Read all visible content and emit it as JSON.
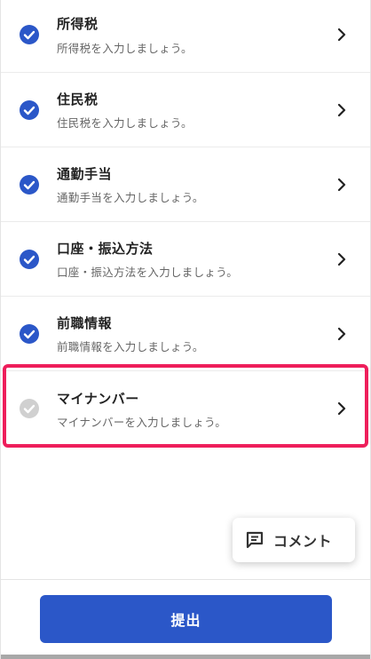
{
  "items": [
    {
      "title": "所得税",
      "subtitle": "所得税を入力しましょう。",
      "completed": true
    },
    {
      "title": "住民税",
      "subtitle": "住民税を入力しましょう。",
      "completed": true
    },
    {
      "title": "通勤手当",
      "subtitle": "通勤手当を入力しましょう。",
      "completed": true
    },
    {
      "title": "口座・振込方法",
      "subtitle": "口座・振込方法を入力しましょう。",
      "completed": true
    },
    {
      "title": "前職情報",
      "subtitle": "前職情報を入力しましょう。",
      "completed": true
    },
    {
      "title": "マイナンバー",
      "subtitle": "マイナンバーを入力しましょう。",
      "completed": false
    }
  ],
  "comment_button": {
    "label": "コメント",
    "icon": "comment-icon"
  },
  "submit_button": {
    "label": "提出"
  },
  "colors": {
    "check_done": "#2b57c8",
    "check_pending": "#d0d0d0",
    "highlight": "#ee1e5b",
    "primary": "#2b57c8"
  }
}
